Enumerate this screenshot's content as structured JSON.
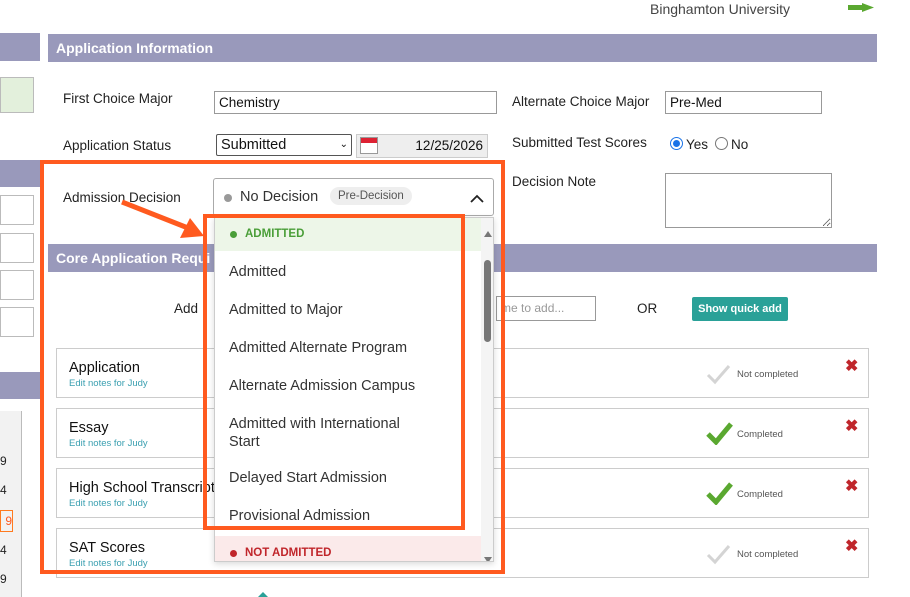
{
  "header": {
    "university": "Binghamton University"
  },
  "app_info": {
    "section_title": "Application Information",
    "first_choice_label": "First Choice Major",
    "first_choice_value": "Chemistry",
    "alternate_label": "Alternate Choice Major",
    "alternate_value": "Pre-Med",
    "status_label": "Application Status",
    "status_value": "Submitted",
    "status_date": "12/25/2026",
    "test_scores_label": "Submitted Test Scores",
    "yes_label": "Yes",
    "no_label": "No",
    "decision_label": "Admission Decision",
    "decision_value": "No Decision",
    "decision_badge": "Pre-Decision",
    "decision_note_label": "Decision Note"
  },
  "dropdown": {
    "group_admitted": "ADMITTED",
    "options": [
      "Admitted",
      "Admitted to Major",
      "Admitted Alternate Program",
      "Alternate Admission Campus",
      "Admitted with International Start",
      "Delayed Start Admission",
      "Provisional Admission"
    ],
    "group_not_admitted": "NOT ADMITTED"
  },
  "core": {
    "section_title": "Core Application Requi",
    "add_label": "Add",
    "add_placeholder": "me to add...",
    "or_label": "OR",
    "quick_add_label": "Show quick add",
    "rows": [
      {
        "title": "Application",
        "sub": "Edit notes for Judy",
        "status": "Not completed",
        "done": false
      },
      {
        "title": "Essay",
        "sub": "Edit notes for Judy",
        "status": "Completed",
        "done": true
      },
      {
        "title": "High School Transcript",
        "sub": "Edit notes for Judy",
        "status": "Completed",
        "done": true
      },
      {
        "title": "SAT Scores",
        "sub": "Edit notes for Judy",
        "status": "Not completed",
        "done": false
      }
    ]
  },
  "left_calendar": {
    "days": [
      "9",
      "4",
      "9",
      "4",
      "9"
    ]
  },
  "colors": {
    "section_bar": "#9999bb",
    "highlight": "#ff5a1f",
    "teal": "#2aa198",
    "check": "#5aa830"
  }
}
